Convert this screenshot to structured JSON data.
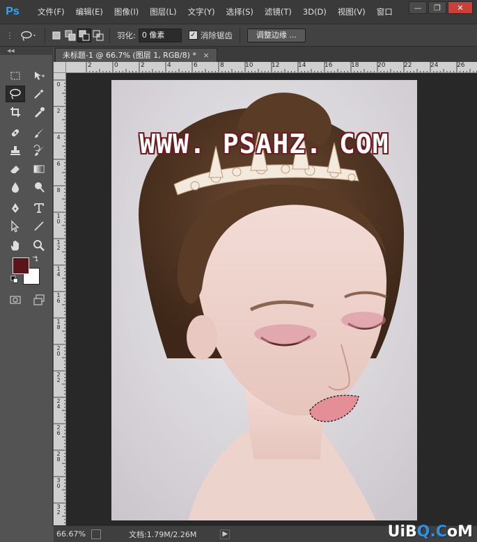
{
  "app": {
    "logo": "Ps"
  },
  "menu": [
    "文件(F)",
    "编辑(E)",
    "图像(I)",
    "图层(L)",
    "文字(Y)",
    "选择(S)",
    "滤镜(T)",
    "3D(D)",
    "视图(V)",
    "窗口"
  ],
  "window_controls": {
    "minimize": "—",
    "restore": "❐",
    "close": "✕"
  },
  "options_bar": {
    "feather_label": "羽化:",
    "feather_value": "0 像素",
    "antialias_checked": true,
    "antialias_label": "消除锯齿",
    "refine_edge_label": "调整边缘 ..."
  },
  "document_tab": {
    "title": "未标题-1 @ 66.7% (图层 1, RGB/8) *",
    "close": "×"
  },
  "ruler_top": [
    "2",
    "0",
    "2",
    "4",
    "6",
    "8",
    "10",
    "12",
    "14",
    "16",
    "18",
    "20",
    "22",
    "24",
    "26"
  ],
  "ruler_left": [
    "0",
    "2",
    "4",
    "6",
    "8",
    "10",
    "12",
    "14",
    "16",
    "18",
    "20",
    "22",
    "24",
    "26",
    "28",
    "30",
    "32"
  ],
  "watermark": "WWW. PSAHZ. COM",
  "colors": {
    "foreground": "#5a1518",
    "background": "#ffffff"
  },
  "status": {
    "zoom": "66.67%",
    "doc_info": "文档:1.79M/2.26M",
    "arrow": "▶"
  },
  "site_logo": {
    "text_a": "UiB",
    "text_o": "Q.C",
    "text_b": "oM"
  }
}
